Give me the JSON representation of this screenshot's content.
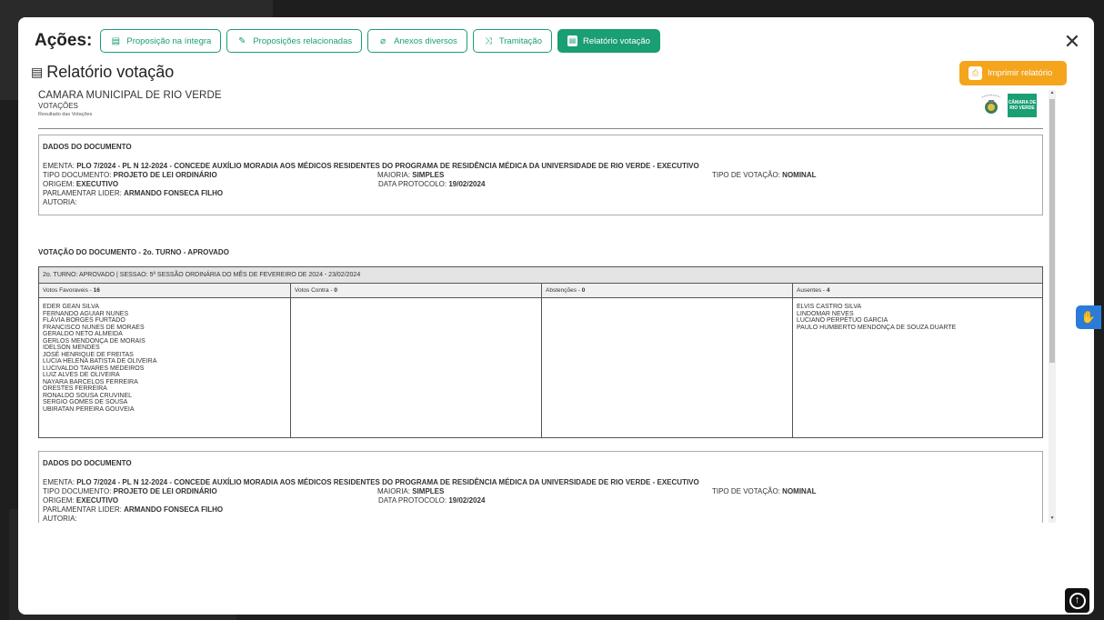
{
  "actions": {
    "label": "Ações:",
    "buttons": [
      {
        "label": "Proposição na íntegra",
        "icon": "file-icon"
      },
      {
        "label": "Proposições relacionadas",
        "icon": "edit-icon"
      },
      {
        "label": "Anexos diversos",
        "icon": "paperclip-icon"
      },
      {
        "label": "Tramitação",
        "icon": "shuffle-icon"
      },
      {
        "label": "Relatório votação",
        "icon": "file-icon",
        "active": true
      }
    ]
  },
  "title": "Relatório votação",
  "print_label": "Imprimir relatório",
  "report": {
    "org": "CAMARA MUNICIPAL DE RIO VERDE",
    "section": "VOTAÇÕES",
    "subsection": "Resultado das Votações",
    "logo_text": "CÂMARA DE RIO VERDE",
    "doc": {
      "heading": "DADOS DO DOCUMENTO",
      "ementa_label": "EMENTA: ",
      "ementa": "PLO 7/2024 - PL N 12-2024 - CONCEDE AUXÍLIO MORADIA AOS MÉDICOS RESIDENTES DO PROGRAMA DE RESIDÊNCIA MÉDICA DA UNIVERSIDADE DE RIO VERDE - EXECUTIVO",
      "tipo_label": "TIPO DOCUMENTO: ",
      "tipo": "PROJETO DE LEI ORDINÁRIO",
      "maioria_label": "MAIORIA: ",
      "maioria": "SIMPLES",
      "tipo_votacao_label": "TIPO DE VOTAÇÃO: ",
      "tipo_votacao": "NOMINAL",
      "origem_label": "ORIGEM: ",
      "origem": "EXECUTIVO",
      "protocolo_label": "DATA PROTOCOLO: ",
      "protocolo": "19/02/2024",
      "parlamentar_label": "PARLAMENTAR LIDER: ",
      "parlamentar": "ARMANDO FONSECA FILHO",
      "autoria_label": "AUTORIA:"
    },
    "votacao_title": "VOTAÇÃO DO DOCUMENTO - 2o. TURNO - APROVADO",
    "sessao": "2o. TURNO: APROVADO | SESSAO: 5ª SESSÃO ORDINÁRIA DO MÊS DE FEVEREIRO DE 2024 - 23/02/2024",
    "cols": {
      "favor_label": "Votos Favoraveis - ",
      "favor_count": "16",
      "contra_label": "Votos Contra - ",
      "contra_count": "0",
      "abst_label": "Abstenções - ",
      "abst_count": "0",
      "aus_label": "Ausentes - ",
      "aus_count": "4"
    },
    "favor": [
      "EDER GEAN SILVA",
      "FERNANDO AGUIAR NUNES",
      "FLÁVIA BORGES FURTADO",
      "FRANCISCO NUNES DE MORAES",
      "GERALDO NETO ALMEIDA",
      "GERLOS MENDONÇA DE MORAIS",
      "IDELSON MENDES",
      "JOSÉ HENRIQUE DE FREITAS",
      "LUCIA HELENA BATISTA DE OLIVEIRA",
      "LUCIVALDO TAVARES MEDEIROS",
      "LUIZ ALVES DE OLIVEIRA",
      "NAYARA BARCELOS FERREIRA",
      "ORESTES FERREIRA",
      "RONALDO SOUSA CRUVINEL",
      "SERGIO GOMES DE SOUSA",
      "UBIRATAN PEREIRA GOUVEIA"
    ],
    "ausentes": [
      "ELVIS CASTRO SILVA",
      "LINDOMAR NEVES",
      "LUCIANO PERPÉTUO GARCIA",
      "PAULO HUMBERTO MENDONÇA DE SOUZA DUARTE"
    ]
  },
  "colors": {
    "accent": "#1a9e74",
    "print": "#f4a51c",
    "a11y": "#2b7bd8"
  }
}
